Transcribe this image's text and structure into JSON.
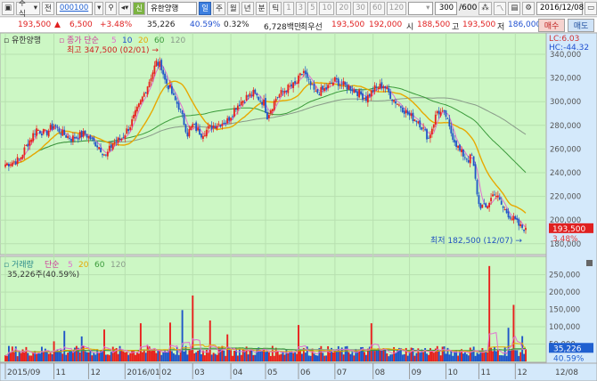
{
  "toolbar": {
    "market": "주식",
    "market_icon": "window-icon",
    "type_btn": "전",
    "code": "000100",
    "search_icon": "magnifier-icon",
    "sound_icon": "speaker-icon",
    "credit_badge": "신",
    "stock_name": "유한양행",
    "periods": [
      "일",
      "주",
      "월",
      "년",
      "분",
      "틱"
    ],
    "active_period": "일",
    "intervals": [
      "1",
      "3",
      "5",
      "10",
      "20",
      "30",
      "60",
      "120"
    ],
    "count": "300",
    "count_max": "/600",
    "date": "2016/12/08"
  },
  "quote": {
    "price": "193,500",
    "arrow": "▲",
    "change": "6,500",
    "change_pct": "+3.48%",
    "volume": "35,226",
    "vol_ratio": "40.59%",
    "turnover_pct": "0.32%",
    "amount": "6,728백만",
    "best_label": "최우선",
    "ask": "193,500",
    "bid": "192,000",
    "open_label": "시",
    "open": "188,500",
    "high_label": "고",
    "high": "193,500",
    "low_label": "저",
    "low": "186,000",
    "buy_label": "매수",
    "sell_label": "매도"
  },
  "colors": {
    "up": "#e8201c",
    "down": "#1f55c8",
    "bg": "#ccf7c4",
    "axis_bg": "#d4e9fb",
    "ma5": "#e070d0",
    "ma20": "#e8a800",
    "ma60": "#3a9a3a",
    "ma120": "#8a9a8a"
  },
  "chart_data": {
    "type": "candlestick",
    "legend": {
      "name": "유한양행",
      "ma_label": "종가 단순",
      "periods": [
        "5",
        "10",
        "20",
        "60",
        "120"
      ]
    },
    "high_note": "최고 347,500 (02/01)",
    "low_note": "최저 182,500 (12/07)",
    "lc": "LC:6.03",
    "hc": "HC:-44.32",
    "price_ticks": [
      "340,000",
      "320,000",
      "300,000",
      "280,000",
      "260,000",
      "240,000",
      "220,000",
      "200,000",
      "180,000"
    ],
    "price_ylim": [
      180000,
      340000
    ],
    "last_price": "193,500",
    "last_pct": "3.48%",
    "close_path": [
      [
        0,
        247000
      ],
      [
        8,
        251000
      ],
      [
        13,
        265000
      ],
      [
        18,
        277000
      ],
      [
        23,
        273000
      ],
      [
        28,
        280000
      ],
      [
        33,
        273000
      ],
      [
        38,
        269000
      ],
      [
        46,
        273000
      ],
      [
        54,
        262000
      ],
      [
        58,
        254000
      ],
      [
        62,
        265000
      ],
      [
        67,
        269000
      ],
      [
        72,
        280000
      ],
      [
        77,
        296000
      ],
      [
        82,
        314000
      ],
      [
        87,
        333000
      ],
      [
        90,
        330000
      ],
      [
        92,
        318000
      ],
      [
        95,
        311000
      ],
      [
        97,
        303000
      ],
      [
        100,
        296000
      ],
      [
        105,
        273000
      ],
      [
        108,
        280000
      ],
      [
        113,
        273000
      ],
      [
        120,
        280000
      ],
      [
        128,
        284000
      ],
      [
        133,
        296000
      ],
      [
        138,
        303000
      ],
      [
        143,
        307000
      ],
      [
        149,
        299000
      ],
      [
        151,
        288000
      ],
      [
        156,
        303000
      ],
      [
        162,
        311000
      ],
      [
        167,
        314000
      ],
      [
        172,
        326000
      ],
      [
        174,
        318000
      ],
      [
        179,
        307000
      ],
      [
        185,
        311000
      ],
      [
        190,
        318000
      ],
      [
        195,
        314000
      ],
      [
        200,
        311000
      ],
      [
        208,
        303000
      ],
      [
        213,
        311000
      ],
      [
        218,
        314000
      ],
      [
        223,
        303000
      ],
      [
        228,
        296000
      ],
      [
        233,
        288000
      ],
      [
        238,
        284000
      ],
      [
        244,
        269000
      ],
      [
        249,
        292000
      ],
      [
        254,
        288000
      ],
      [
        256,
        277000
      ],
      [
        262,
        258000
      ],
      [
        267,
        251000
      ],
      [
        269,
        254000
      ],
      [
        273,
        213000
      ],
      [
        277,
        210000
      ],
      [
        282,
        224000
      ],
      [
        287,
        210000
      ],
      [
        292,
        202000
      ],
      [
        297,
        194000
      ],
      [
        300,
        193500
      ]
    ],
    "volume": {
      "legend_label": "거래량",
      "ma_label": "단순",
      "periods": [
        "5",
        "20",
        "60",
        "120"
      ],
      "current": "35,226주(40.59%)",
      "ticks": [
        "250,000",
        "200,000",
        "150,000",
        "100,000",
        "50,000"
      ],
      "ylim": [
        0,
        290000
      ],
      "last": "35,226",
      "last_pct": "40.59%",
      "spikes": [
        [
          28,
          58000
        ],
        [
          34,
          88000
        ],
        [
          44,
          72000
        ],
        [
          57,
          92000
        ],
        [
          78,
          110000
        ],
        [
          95,
          112000
        ],
        [
          102,
          148000
        ],
        [
          108,
          190000
        ],
        [
          118,
          118000
        ],
        [
          128,
          78000
        ],
        [
          169,
          105000
        ],
        [
          211,
          110000
        ],
        [
          279,
          275000
        ],
        [
          290,
          97000
        ],
        [
          298,
          73000
        ],
        [
          293,
          163000
        ],
        [
          300,
          86000
        ]
      ]
    },
    "x_ticks": [
      [
        "2015/09",
        0
      ],
      [
        "11",
        28
      ],
      [
        "12",
        48
      ],
      [
        "2016/01",
        69
      ],
      [
        "02",
        89
      ],
      [
        "03",
        108
      ],
      [
        "04",
        130
      ],
      [
        "05",
        150
      ],
      [
        "06",
        169
      ],
      [
        "07",
        190
      ],
      [
        "08",
        212
      ],
      [
        "09",
        233
      ],
      [
        "10",
        254
      ],
      [
        "11",
        273
      ],
      [
        "12",
        294
      ]
    ],
    "x_end_label": "12/08"
  }
}
